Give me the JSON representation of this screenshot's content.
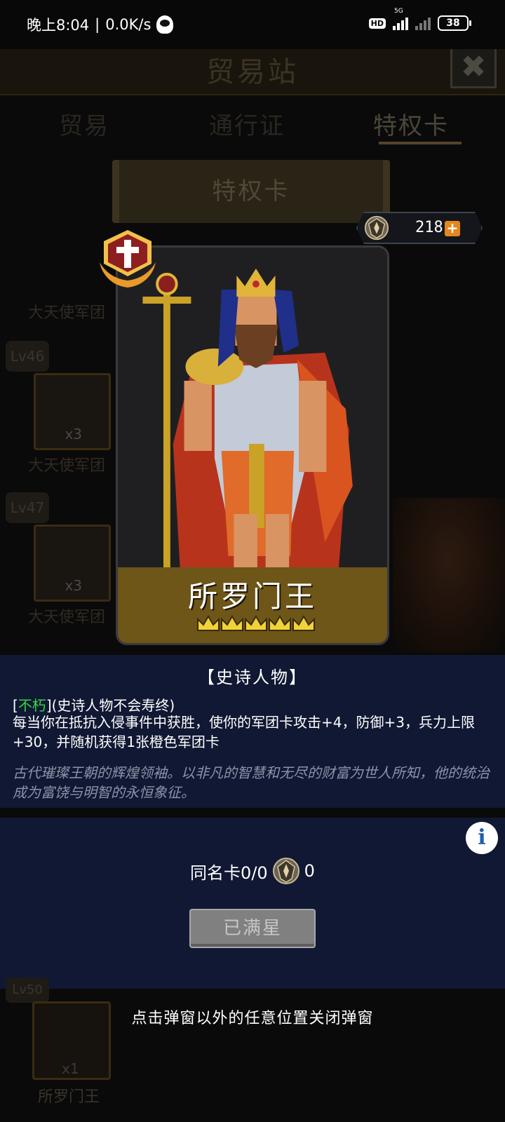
{
  "status_bar": {
    "time": "晚上8:04",
    "speed": "0.0K/s",
    "hd": "HD",
    "network": "5G",
    "battery": "38"
  },
  "header": {
    "title": "贸易站"
  },
  "tabs": [
    {
      "label": "贸易"
    },
    {
      "label": "通行证"
    },
    {
      "label": "特权卡"
    }
  ],
  "banner": {
    "label": "特权卡"
  },
  "currency": {
    "value": "218"
  },
  "background_list": {
    "items": [
      {
        "name": "大天使军团"
      },
      {
        "level": "Lv46",
        "count": "x3",
        "name": "大天使军团"
      },
      {
        "level": "Lv47",
        "count": "x3",
        "name": "大天使军团"
      }
    ],
    "bottom_item": {
      "level": "Lv50",
      "count": "x1",
      "name": "所罗门王"
    }
  },
  "card": {
    "name": "所罗门王",
    "stars": 5
  },
  "description": {
    "rarity": "【史诗人物】",
    "trait_bracket_open": "[",
    "trait_tag": "不朽",
    "trait_rest": "](史诗人物不会寿终)",
    "effect": "每当你在抵抗入侵事件中获胜，使你的军团卡攻击+4，防御+3，兵力上限+30，并随机获得1张橙色军团卡",
    "lore": "古代璀璨王朝的辉煌领袖。以非凡的智慧和无尽的财富为世人所知，他的统治成为富饶与明智的永恒象征。"
  },
  "duplicates": {
    "label": "同名卡0/0",
    "crest_count": "0"
  },
  "actions": {
    "maxed_label": "已满星"
  },
  "hint": "点击弹窗以外的任意位置关闭弹窗",
  "colors": {
    "trait_green": "#37d645",
    "panel_navy": "#101833",
    "name_band_gold": "#6e5518",
    "plus_orange": "#e6861f"
  }
}
